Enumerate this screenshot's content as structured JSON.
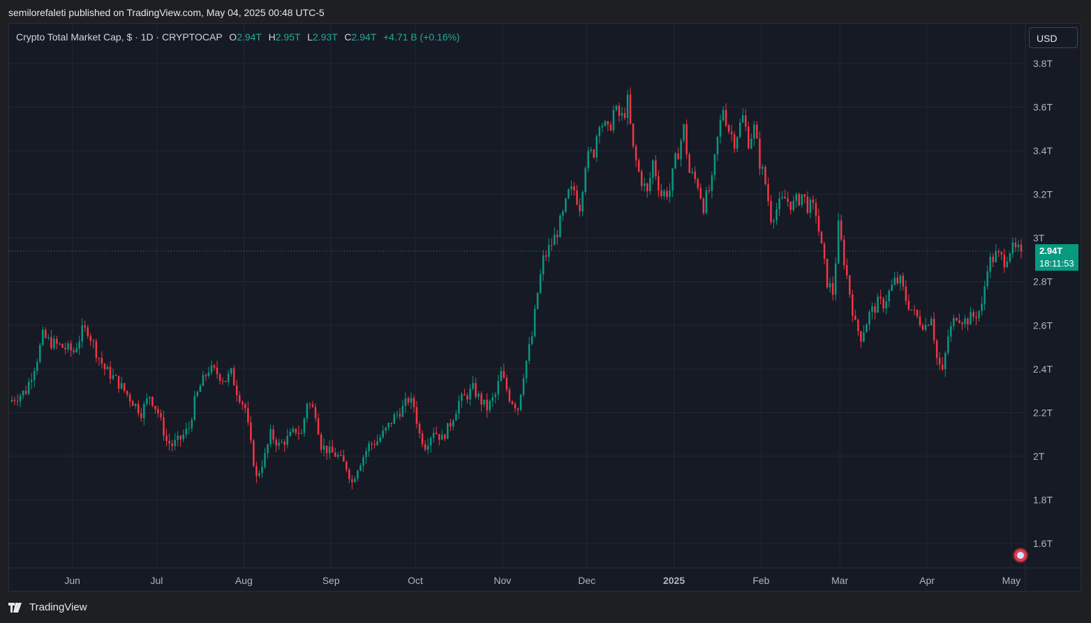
{
  "header": {
    "published": "semilorefaleti published on TradingView.com, May 04, 2025 00:48 UTC-5"
  },
  "legend": {
    "symbol": "Crypto Total Market Cap, $ · 1D · CRYPTOCAP",
    "o_label": "O",
    "o": "2.94T",
    "h_label": "H",
    "h": "2.95T",
    "l_label": "L",
    "l": "2.93T",
    "c_label": "C",
    "c": "2.94T",
    "change": "+4.71 B (+0.16%)"
  },
  "currency_button": "USD",
  "last_price": {
    "value": "2.94T",
    "countdown": "18:11:53"
  },
  "footer": {
    "brand": "TradingView"
  },
  "colors": {
    "up": "#089981",
    "down": "#f23645",
    "background": "#161a25",
    "grid": "#232732"
  },
  "chart_data": {
    "type": "candlestick",
    "title": "Crypto Total Market Cap, $ · 1D · CRYPTOCAP",
    "y_unit": "T",
    "ylim": [
      1.5,
      3.85
    ],
    "y_ticks": [
      "3.8T",
      "3.6T",
      "3.4T",
      "3.2T",
      "3T",
      "2.8T",
      "2.6T",
      "2.4T",
      "2.2T",
      "2T",
      "1.8T",
      "1.6T"
    ],
    "y_tick_values": [
      3.8,
      3.6,
      3.4,
      3.2,
      3.0,
      2.8,
      2.6,
      2.4,
      2.2,
      2.0,
      1.8,
      1.6
    ],
    "x_ticks": [
      {
        "label": "Jun",
        "day": 22
      },
      {
        "label": "Jul",
        "day": 52
      },
      {
        "label": "Aug",
        "day": 83
      },
      {
        "label": "Sep",
        "day": 114
      },
      {
        "label": "Oct",
        "day": 144
      },
      {
        "label": "Nov",
        "day": 175
      },
      {
        "label": "Dec",
        "day": 205
      },
      {
        "label": "2025",
        "day": 236,
        "bold": true
      },
      {
        "label": "Feb",
        "day": 267
      },
      {
        "label": "Mar",
        "day": 295
      },
      {
        "label": "Apr",
        "day": 326
      },
      {
        "label": "May",
        "day": 356
      }
    ],
    "x_range_days": [
      0,
      360
    ],
    "grid": true,
    "last_price": 2.94,
    "anchors": [
      [
        0,
        2.25
      ],
      [
        6,
        2.3
      ],
      [
        10,
        2.45
      ],
      [
        12,
        2.55
      ],
      [
        15,
        2.52
      ],
      [
        19,
        2.5
      ],
      [
        23,
        2.48
      ],
      [
        26,
        2.57
      ],
      [
        28,
        2.58
      ],
      [
        31,
        2.48
      ],
      [
        34,
        2.4
      ],
      [
        38,
        2.35
      ],
      [
        41,
        2.3
      ],
      [
        44,
        2.25
      ],
      [
        47,
        2.2
      ],
      [
        50,
        2.28
      ],
      [
        53,
        2.2
      ],
      [
        56,
        2.07
      ],
      [
        58,
        2.05
      ],
      [
        61,
        2.08
      ],
      [
        64,
        2.13
      ],
      [
        66,
        2.25
      ],
      [
        68,
        2.32
      ],
      [
        71,
        2.4
      ],
      [
        74,
        2.38
      ],
      [
        77,
        2.35
      ],
      [
        79,
        2.38
      ],
      [
        81,
        2.3
      ],
      [
        84,
        2.22
      ],
      [
        86,
        2.05
      ],
      [
        88,
        1.9
      ],
      [
        91,
        2.0
      ],
      [
        93,
        2.1
      ],
      [
        96,
        2.05
      ],
      [
        99,
        2.08
      ],
      [
        102,
        2.12
      ],
      [
        104,
        2.1
      ],
      [
        106,
        2.25
      ],
      [
        109,
        2.2
      ],
      [
        111,
        2.05
      ],
      [
        114,
        2.02
      ],
      [
        117,
        2.0
      ],
      [
        120,
        1.95
      ],
      [
        122,
        1.88
      ],
      [
        124,
        1.95
      ],
      [
        126,
        2.0
      ],
      [
        128,
        2.05
      ],
      [
        131,
        2.07
      ],
      [
        134,
        2.12
      ],
      [
        137,
        2.18
      ],
      [
        140,
        2.22
      ],
      [
        142,
        2.26
      ],
      [
        144,
        2.23
      ],
      [
        146,
        2.1
      ],
      [
        148,
        2.05
      ],
      [
        151,
        2.12
      ],
      [
        154,
        2.08
      ],
      [
        157,
        2.15
      ],
      [
        160,
        2.25
      ],
      [
        163,
        2.28
      ],
      [
        165,
        2.31
      ],
      [
        168,
        2.25
      ],
      [
        170,
        2.22
      ],
      [
        173,
        2.28
      ],
      [
        175,
        2.38
      ],
      [
        178,
        2.27
      ],
      [
        181,
        2.22
      ],
      [
        183,
        2.38
      ],
      [
        186,
        2.55
      ],
      [
        188,
        2.75
      ],
      [
        190,
        2.9
      ],
      [
        192,
        2.95
      ],
      [
        194,
        3.0
      ],
      [
        197,
        3.1
      ],
      [
        199,
        3.2
      ],
      [
        201,
        3.22
      ],
      [
        203,
        3.15
      ],
      [
        205,
        3.35
      ],
      [
        208,
        3.4
      ],
      [
        210,
        3.55
      ],
      [
        213,
        3.48
      ],
      [
        215,
        3.58
      ],
      [
        218,
        3.55
      ],
      [
        220,
        3.62
      ],
      [
        222,
        3.4
      ],
      [
        224,
        3.3
      ],
      [
        227,
        3.2
      ],
      [
        229,
        3.35
      ],
      [
        232,
        3.2
      ],
      [
        235,
        3.22
      ],
      [
        237,
        3.35
      ],
      [
        240,
        3.5
      ],
      [
        242,
        3.3
      ],
      [
        245,
        3.25
      ],
      [
        247,
        3.15
      ],
      [
        250,
        3.25
      ],
      [
        252,
        3.45
      ],
      [
        254,
        3.6
      ],
      [
        256,
        3.5
      ],
      [
        258,
        3.45
      ],
      [
        261,
        3.55
      ],
      [
        263,
        3.45
      ],
      [
        265,
        3.5
      ],
      [
        267,
        3.35
      ],
      [
        269,
        3.25
      ],
      [
        271,
        3.1
      ],
      [
        274,
        3.15
      ],
      [
        276,
        3.18
      ],
      [
        279,
        3.15
      ],
      [
        282,
        3.2
      ],
      [
        284,
        3.15
      ],
      [
        287,
        3.12
      ],
      [
        289,
        2.95
      ],
      [
        291,
        2.8
      ],
      [
        293,
        2.75
      ],
      [
        295,
        3.05
      ],
      [
        297,
        2.9
      ],
      [
        299,
        2.75
      ],
      [
        301,
        2.6
      ],
      [
        303,
        2.55
      ],
      [
        306,
        2.65
      ],
      [
        309,
        2.7
      ],
      [
        311,
        2.7
      ],
      [
        313,
        2.75
      ],
      [
        315,
        2.8
      ],
      [
        317,
        2.8
      ],
      [
        319,
        2.72
      ],
      [
        322,
        2.65
      ],
      [
        324,
        2.62
      ],
      [
        326,
        2.6
      ],
      [
        328,
        2.65
      ],
      [
        330,
        2.45
      ],
      [
        332,
        2.38
      ],
      [
        334,
        2.55
      ],
      [
        337,
        2.65
      ],
      [
        340,
        2.62
      ],
      [
        343,
        2.64
      ],
      [
        346,
        2.68
      ],
      [
        348,
        2.88
      ],
      [
        351,
        2.92
      ],
      [
        354,
        2.9
      ],
      [
        356,
        2.95
      ],
      [
        358,
        2.94
      ]
    ]
  }
}
